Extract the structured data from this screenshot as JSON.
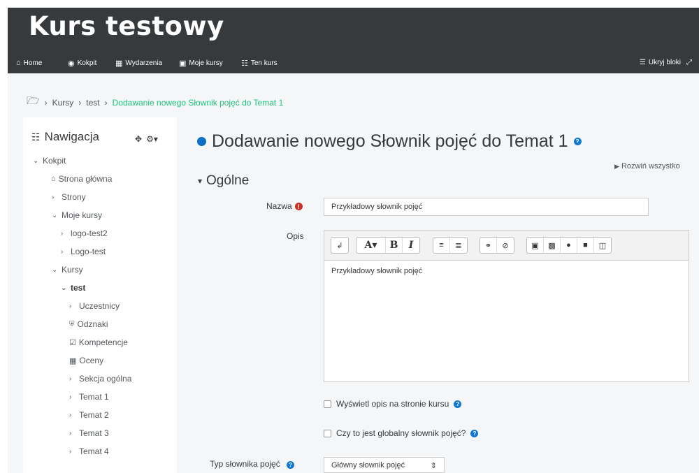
{
  "header": {
    "site_title": "Kurs testowy",
    "nav": [
      {
        "icon": "home-icon",
        "label": "Home"
      },
      {
        "icon": "dashboard-icon",
        "label": "Kokpit"
      },
      {
        "icon": "calendar-icon",
        "label": "Wydarzenia"
      },
      {
        "icon": "briefcase-icon",
        "label": "Moje kursy"
      },
      {
        "icon": "sitemap-icon",
        "label": "Ten kurs"
      }
    ],
    "hide_blocks_label": "Ukryj bloki"
  },
  "breadcrumb": {
    "items": [
      "Kursy",
      "test"
    ],
    "current": "Dodawanie nowego Słownik pojęć do Temat 1"
  },
  "navigation_block": {
    "title": "Nawigacja",
    "items": [
      {
        "label": "Kokpit"
      },
      {
        "label": "Strona główna"
      },
      {
        "label": "Strony"
      },
      {
        "label": "Moje kursy"
      },
      {
        "label": "logo-test2"
      },
      {
        "label": "Logo-test"
      },
      {
        "label": "Kursy"
      },
      {
        "label": "test"
      },
      {
        "label": "Uczestnicy"
      },
      {
        "label": "Odznaki"
      },
      {
        "label": "Kompetencje"
      },
      {
        "label": "Oceny"
      },
      {
        "label": "Sekcja ogólna"
      },
      {
        "label": "Temat 1"
      },
      {
        "label": "Temat 2"
      },
      {
        "label": "Temat 3"
      },
      {
        "label": "Temat 4"
      }
    ]
  },
  "main": {
    "heading": "Dodawanie nowego Słownik pojęć do Temat 1",
    "expand_all": "Rozwiń wszystko",
    "section_title": "Ogólne",
    "name_label": "Nazwa",
    "name_value": "Przykładowy słownik pojęć",
    "description_label": "Opis",
    "description_value": "Przykładowy słownik pojęć",
    "show_description_label": "Wyświetl opis na stronie kursu",
    "global_glossary_label": "Czy to jest globalny słownik pojęć?",
    "glossary_type_label": "Typ słownika pojęć",
    "glossary_type_value": "Główny słownik pojęć"
  },
  "colors": {
    "header_bg": "#373a3c",
    "page_bg": "#f4f6f7",
    "breadcrumb_current": "#1ec47d",
    "help_icon": "#1177d1",
    "required_icon": "#ca3120"
  }
}
